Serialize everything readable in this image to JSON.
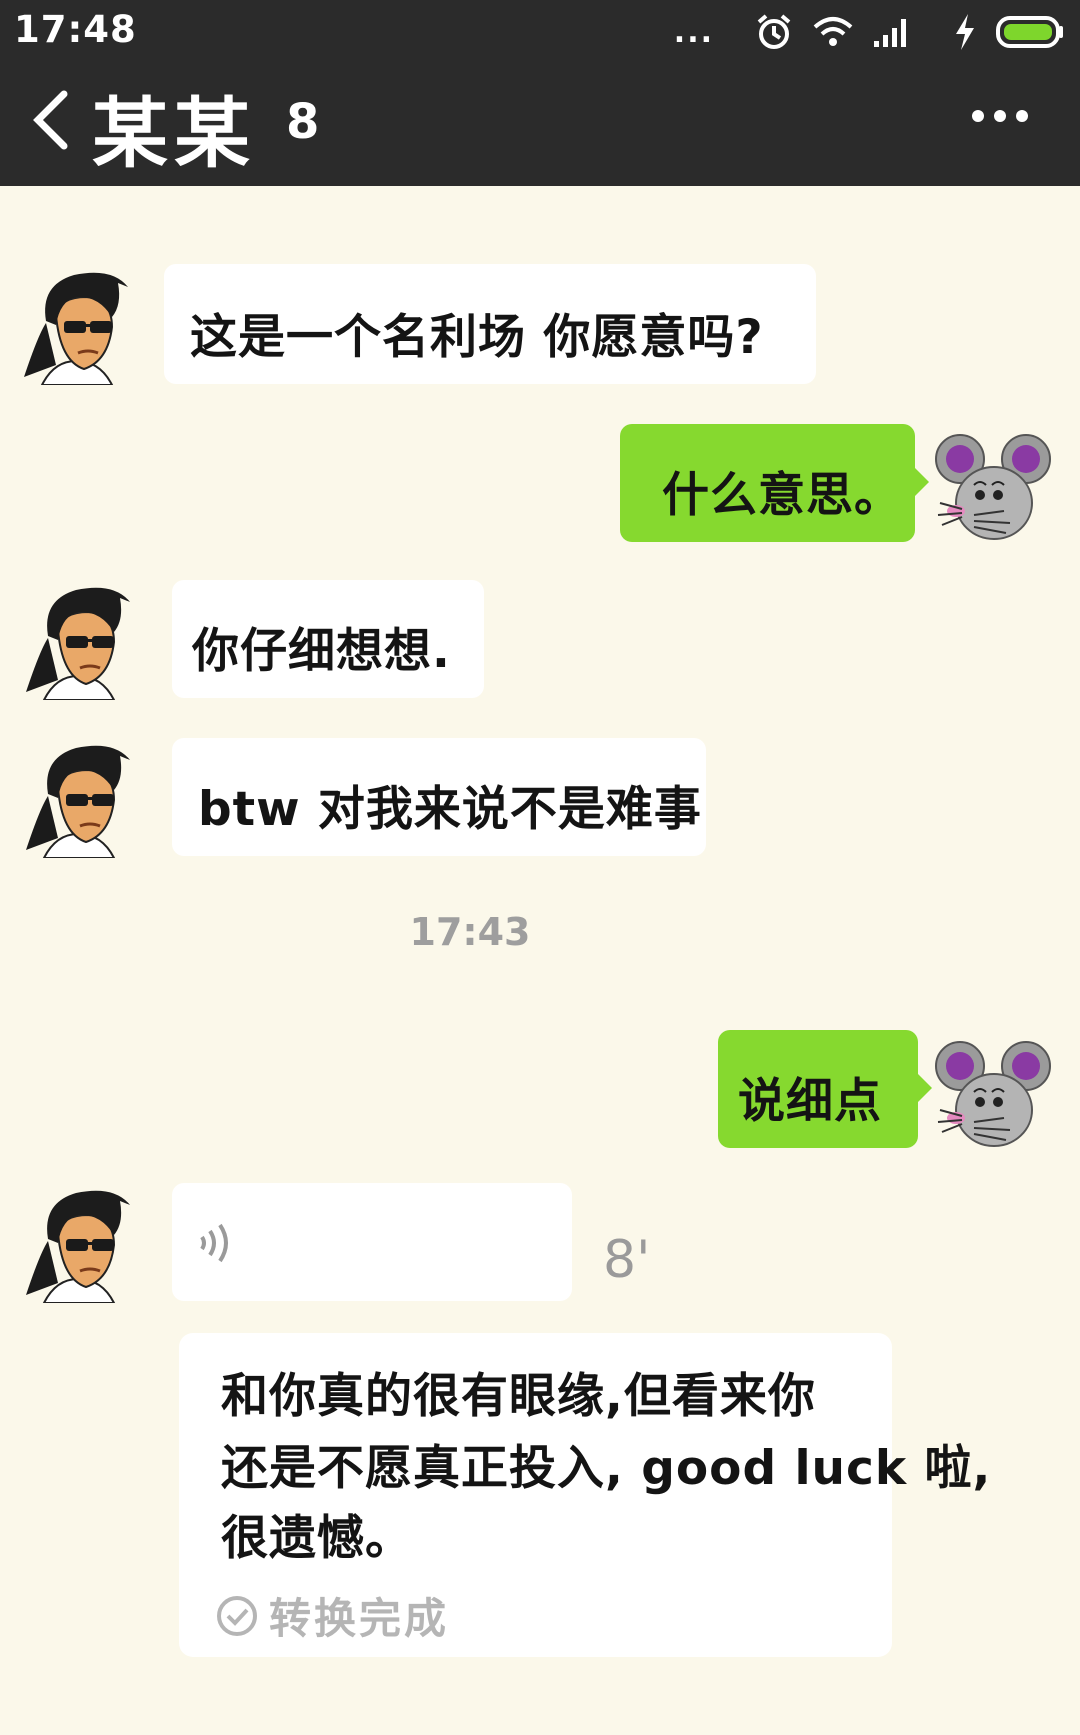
{
  "status_bar": {
    "time": "17:48",
    "overflow_dots": "...",
    "icons": [
      "alarm-icon",
      "wifi-icon",
      "signal-icon",
      "charging-icon",
      "battery-icon"
    ]
  },
  "header": {
    "back_icon": "back-chevron-icon",
    "title": "某某",
    "title_extra": "8",
    "more_icon": "more-dots-icon"
  },
  "messages": [
    {
      "side": "left",
      "sender": "contact",
      "text": "这是一个名利场 你愿意吗?"
    },
    {
      "side": "right",
      "sender": "me",
      "text": "什么意思。"
    },
    {
      "side": "left",
      "sender": "contact",
      "text": "你仔细想想."
    },
    {
      "side": "left",
      "sender": "contact",
      "text": "btw 对我来说不是难事"
    },
    {
      "type": "timestamp",
      "text": "17:43"
    },
    {
      "side": "right",
      "sender": "me",
      "text": "说细点"
    },
    {
      "side": "left",
      "sender": "contact",
      "type": "voice",
      "duration": "8'"
    }
  ],
  "transcript": {
    "lines": [
      "和你真的很有眼缘,但看来你",
      "还是不愿真正投入, good luck 啦,",
      "很遗憾。"
    ],
    "status": "转换完成"
  },
  "colors": {
    "header_bg": "#2b2b2b",
    "chat_bg": "#fbf8ea",
    "my_bubble": "#86d92f",
    "their_bubble": "#ffffff",
    "muted_text": "#9e9e9e"
  }
}
